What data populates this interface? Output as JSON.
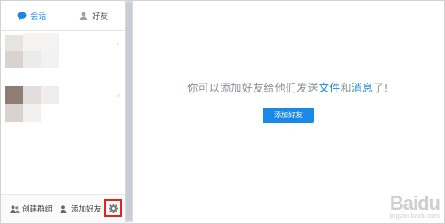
{
  "tabs": [
    {
      "label": "会话",
      "icon": "chat-bubble-icon",
      "active": true
    },
    {
      "label": "好友",
      "icon": "person-icon",
      "active": false
    }
  ],
  "conversation_rows_count_visible": 2,
  "bottom_bar": {
    "create_group_label": "创建群组",
    "add_friend_label": "添加好友",
    "settings_icon": "gear-icon",
    "highlight_color": "#e02424"
  },
  "main": {
    "message_prefix": "你可以添加好友给他们发送",
    "link_files": "文件",
    "conjunction": "和",
    "link_messages": "消息",
    "message_suffix": "了!",
    "add_friend_button": "添加好友"
  },
  "watermark": {
    "brand": "Baidu",
    "sub_text": "jingyan.baidu.com"
  },
  "colors": {
    "accent": "#1a88e6",
    "muted_text": "#8a8f96",
    "border": "#d6dadf"
  }
}
